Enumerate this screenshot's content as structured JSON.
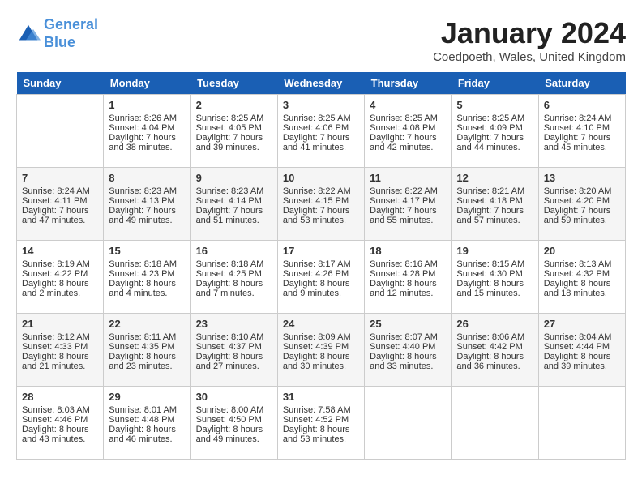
{
  "header": {
    "logo_line1": "General",
    "logo_line2": "Blue",
    "month": "January 2024",
    "location": "Coedpoeth, Wales, United Kingdom"
  },
  "weekdays": [
    "Sunday",
    "Monday",
    "Tuesday",
    "Wednesday",
    "Thursday",
    "Friday",
    "Saturday"
  ],
  "weeks": [
    [
      {
        "day": "",
        "info": ""
      },
      {
        "day": "1",
        "info": "Sunrise: 8:26 AM\nSunset: 4:04 PM\nDaylight: 7 hours\nand 38 minutes."
      },
      {
        "day": "2",
        "info": "Sunrise: 8:25 AM\nSunset: 4:05 PM\nDaylight: 7 hours\nand 39 minutes."
      },
      {
        "day": "3",
        "info": "Sunrise: 8:25 AM\nSunset: 4:06 PM\nDaylight: 7 hours\nand 41 minutes."
      },
      {
        "day": "4",
        "info": "Sunrise: 8:25 AM\nSunset: 4:08 PM\nDaylight: 7 hours\nand 42 minutes."
      },
      {
        "day": "5",
        "info": "Sunrise: 8:25 AM\nSunset: 4:09 PM\nDaylight: 7 hours\nand 44 minutes."
      },
      {
        "day": "6",
        "info": "Sunrise: 8:24 AM\nSunset: 4:10 PM\nDaylight: 7 hours\nand 45 minutes."
      }
    ],
    [
      {
        "day": "7",
        "info": "Sunrise: 8:24 AM\nSunset: 4:11 PM\nDaylight: 7 hours\nand 47 minutes."
      },
      {
        "day": "8",
        "info": "Sunrise: 8:23 AM\nSunset: 4:13 PM\nDaylight: 7 hours\nand 49 minutes."
      },
      {
        "day": "9",
        "info": "Sunrise: 8:23 AM\nSunset: 4:14 PM\nDaylight: 7 hours\nand 51 minutes."
      },
      {
        "day": "10",
        "info": "Sunrise: 8:22 AM\nSunset: 4:15 PM\nDaylight: 7 hours\nand 53 minutes."
      },
      {
        "day": "11",
        "info": "Sunrise: 8:22 AM\nSunset: 4:17 PM\nDaylight: 7 hours\nand 55 minutes."
      },
      {
        "day": "12",
        "info": "Sunrise: 8:21 AM\nSunset: 4:18 PM\nDaylight: 7 hours\nand 57 minutes."
      },
      {
        "day": "13",
        "info": "Sunrise: 8:20 AM\nSunset: 4:20 PM\nDaylight: 7 hours\nand 59 minutes."
      }
    ],
    [
      {
        "day": "14",
        "info": "Sunrise: 8:19 AM\nSunset: 4:22 PM\nDaylight: 8 hours\nand 2 minutes."
      },
      {
        "day": "15",
        "info": "Sunrise: 8:18 AM\nSunset: 4:23 PM\nDaylight: 8 hours\nand 4 minutes."
      },
      {
        "day": "16",
        "info": "Sunrise: 8:18 AM\nSunset: 4:25 PM\nDaylight: 8 hours\nand 7 minutes."
      },
      {
        "day": "17",
        "info": "Sunrise: 8:17 AM\nSunset: 4:26 PM\nDaylight: 8 hours\nand 9 minutes."
      },
      {
        "day": "18",
        "info": "Sunrise: 8:16 AM\nSunset: 4:28 PM\nDaylight: 8 hours\nand 12 minutes."
      },
      {
        "day": "19",
        "info": "Sunrise: 8:15 AM\nSunset: 4:30 PM\nDaylight: 8 hours\nand 15 minutes."
      },
      {
        "day": "20",
        "info": "Sunrise: 8:13 AM\nSunset: 4:32 PM\nDaylight: 8 hours\nand 18 minutes."
      }
    ],
    [
      {
        "day": "21",
        "info": "Sunrise: 8:12 AM\nSunset: 4:33 PM\nDaylight: 8 hours\nand 21 minutes."
      },
      {
        "day": "22",
        "info": "Sunrise: 8:11 AM\nSunset: 4:35 PM\nDaylight: 8 hours\nand 23 minutes."
      },
      {
        "day": "23",
        "info": "Sunrise: 8:10 AM\nSunset: 4:37 PM\nDaylight: 8 hours\nand 27 minutes."
      },
      {
        "day": "24",
        "info": "Sunrise: 8:09 AM\nSunset: 4:39 PM\nDaylight: 8 hours\nand 30 minutes."
      },
      {
        "day": "25",
        "info": "Sunrise: 8:07 AM\nSunset: 4:40 PM\nDaylight: 8 hours\nand 33 minutes."
      },
      {
        "day": "26",
        "info": "Sunrise: 8:06 AM\nSunset: 4:42 PM\nDaylight: 8 hours\nand 36 minutes."
      },
      {
        "day": "27",
        "info": "Sunrise: 8:04 AM\nSunset: 4:44 PM\nDaylight: 8 hours\nand 39 minutes."
      }
    ],
    [
      {
        "day": "28",
        "info": "Sunrise: 8:03 AM\nSunset: 4:46 PM\nDaylight: 8 hours\nand 43 minutes."
      },
      {
        "day": "29",
        "info": "Sunrise: 8:01 AM\nSunset: 4:48 PM\nDaylight: 8 hours\nand 46 minutes."
      },
      {
        "day": "30",
        "info": "Sunrise: 8:00 AM\nSunset: 4:50 PM\nDaylight: 8 hours\nand 49 minutes."
      },
      {
        "day": "31",
        "info": "Sunrise: 7:58 AM\nSunset: 4:52 PM\nDaylight: 8 hours\nand 53 minutes."
      },
      {
        "day": "",
        "info": ""
      },
      {
        "day": "",
        "info": ""
      },
      {
        "day": "",
        "info": ""
      }
    ]
  ]
}
